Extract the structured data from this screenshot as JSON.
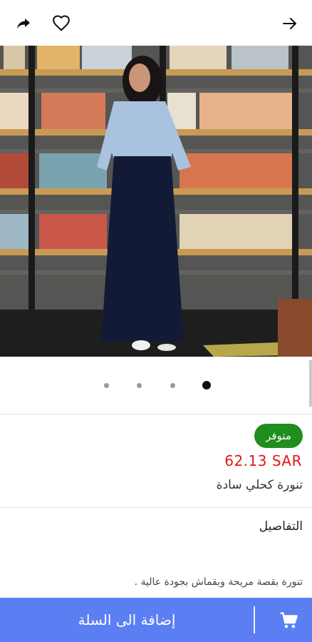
{
  "header": {
    "share_icon": "share-icon",
    "favorite_icon": "heart-outline-icon",
    "back_icon": "arrow-right-icon"
  },
  "gallery": {
    "image_description": "product-photo-navy-skirt",
    "total_slides": 4,
    "active_slide": 4
  },
  "product": {
    "availability": "متوفر",
    "price": "62.13 SAR",
    "name": "تنورة كحلي سادة"
  },
  "details": {
    "title": "التفاصيل",
    "description": "تنورة بقصة مريحة وبقماش بجودة عالية ."
  },
  "footer": {
    "add_to_cart_label": "إضافة الى السلة",
    "cart_icon": "cart-icon"
  },
  "colors": {
    "accent": "#5b7ff3",
    "available": "#1f8e1f",
    "price": "#e01818"
  }
}
